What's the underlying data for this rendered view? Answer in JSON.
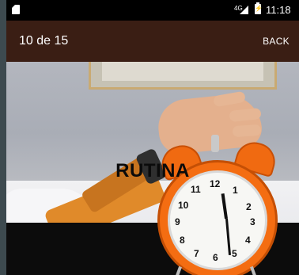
{
  "statusbar": {
    "network_label": "4G",
    "time": "11:18"
  },
  "appbar": {
    "title": "10 de 15",
    "back_label": "BACK",
    "background": "#3a1e14"
  },
  "content": {
    "overlay_title": "RUTINA",
    "clock_numbers": [
      "12",
      "1",
      "2",
      "3",
      "4",
      "5",
      "6",
      "7",
      "8",
      "9",
      "10",
      "11"
    ]
  }
}
